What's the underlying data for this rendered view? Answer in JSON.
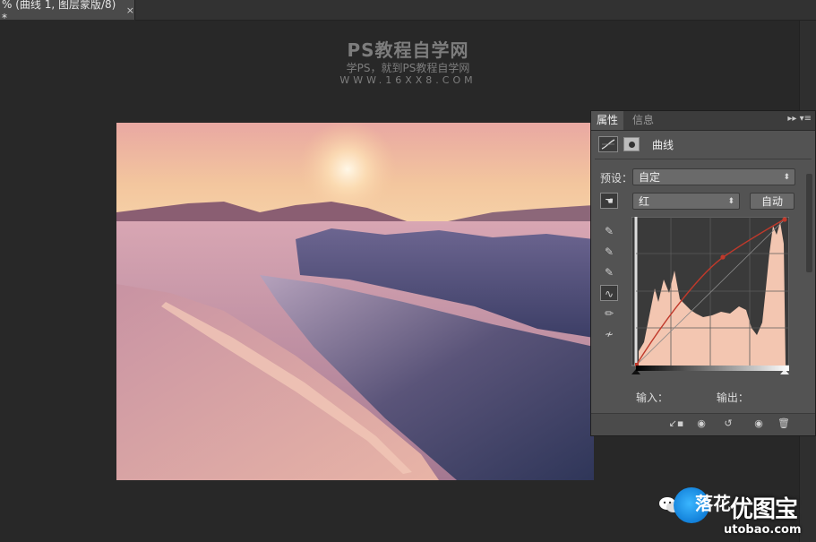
{
  "document": {
    "tab_title": "% (曲线 1, 图层蒙版/8) *",
    "close_glyph": "×"
  },
  "watermark": {
    "line1": "PS教程自学网",
    "line2": "学PS，就到PS教程自学网",
    "line3": "WWW.16XX8.COM"
  },
  "properties_panel": {
    "tabs": [
      "属性",
      "信息"
    ],
    "menu_glyph": "▸▸ ▾≡",
    "adjustment_title": "曲线",
    "preset_label": "预设：",
    "preset_value": "自定",
    "channel_value": "红",
    "auto_label": "自动",
    "input_label": "输入：",
    "output_label": "输出：",
    "colors": {
      "panel_bg": "#535353",
      "histogram": "#f4c7b3",
      "curve": "#c0392b"
    }
  },
  "logo": {
    "brand_partial": "落花",
    "brand": "优图宝",
    "url": "utobao.com"
  }
}
